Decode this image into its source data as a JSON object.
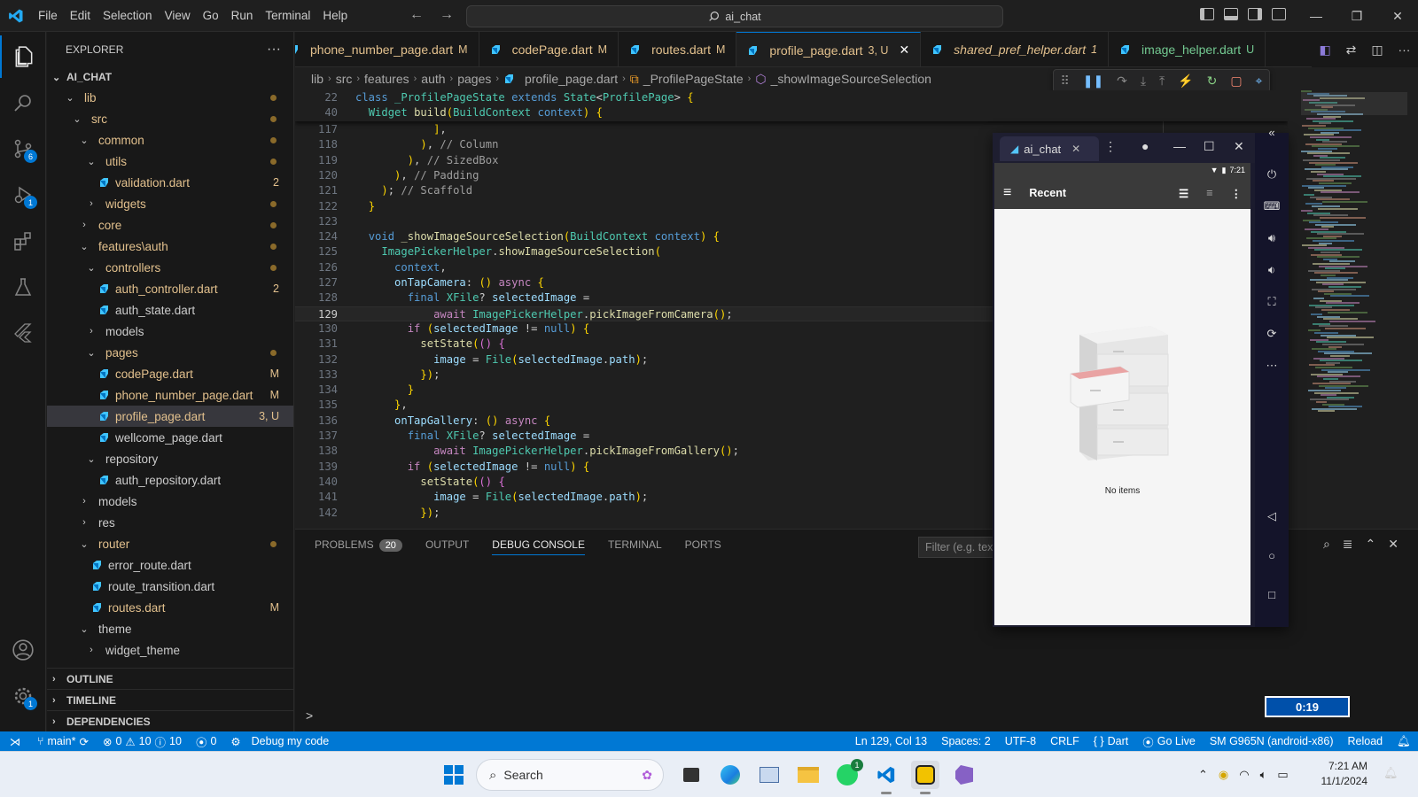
{
  "menu": [
    "File",
    "Edit",
    "Selection",
    "View",
    "Go",
    "Run",
    "Terminal",
    "Help"
  ],
  "command_center": "ai_chat",
  "activity_badges": {
    "source_control": "6",
    "run_debug": "1",
    "accounts_settings": "1"
  },
  "sidebar": {
    "title": "EXPLORER",
    "more": "···",
    "root": "AI_CHAT",
    "tree": [
      {
        "label": "lib",
        "depth": 1,
        "type": "folder-open",
        "color": "yellow",
        "deco": "dot"
      },
      {
        "label": "src",
        "depth": 2,
        "type": "folder-open",
        "color": "yellow",
        "deco": "dot"
      },
      {
        "label": "common",
        "depth": 3,
        "type": "folder-open",
        "color": "yellow",
        "deco": "dot"
      },
      {
        "label": "utils",
        "depth": 4,
        "type": "folder-open",
        "color": "yellow",
        "deco": "dot"
      },
      {
        "label": "validation.dart",
        "depth": 5,
        "type": "file",
        "color": "yellow",
        "deco": "2"
      },
      {
        "label": "widgets",
        "depth": 4,
        "type": "folder",
        "color": "yellow",
        "deco": "dot"
      },
      {
        "label": "core",
        "depth": 3,
        "type": "folder",
        "color": "yellow",
        "deco": "dot"
      },
      {
        "label": "features\\auth",
        "depth": 3,
        "type": "folder-open",
        "color": "yellow",
        "deco": "dot"
      },
      {
        "label": "controllers",
        "depth": 4,
        "type": "folder-open",
        "color": "yellow",
        "deco": "dot"
      },
      {
        "label": "auth_controller.dart",
        "depth": 5,
        "type": "file",
        "color": "yellow",
        "deco": "2"
      },
      {
        "label": "auth_state.dart",
        "depth": 5,
        "type": "file",
        "color": "plain",
        "deco": ""
      },
      {
        "label": "models",
        "depth": 4,
        "type": "folder",
        "color": "plain",
        "deco": ""
      },
      {
        "label": "pages",
        "depth": 4,
        "type": "folder-open",
        "color": "yellow",
        "deco": "dot"
      },
      {
        "label": "codePage.dart",
        "depth": 5,
        "type": "file",
        "color": "yellow",
        "deco": "M"
      },
      {
        "label": "phone_number_page.dart",
        "depth": 5,
        "type": "file",
        "color": "yellow",
        "deco": "M"
      },
      {
        "label": "profile_page.dart",
        "depth": 5,
        "type": "file",
        "color": "yellow",
        "deco": "3, U",
        "selected": true
      },
      {
        "label": "wellcome_page.dart",
        "depth": 5,
        "type": "file",
        "color": "plain",
        "deco": ""
      },
      {
        "label": "repository",
        "depth": 4,
        "type": "folder-open",
        "color": "plain",
        "deco": ""
      },
      {
        "label": "auth_repository.dart",
        "depth": 5,
        "type": "file",
        "color": "plain",
        "deco": ""
      },
      {
        "label": "models",
        "depth": 3,
        "type": "folder",
        "color": "plain",
        "deco": ""
      },
      {
        "label": "res",
        "depth": 3,
        "type": "folder",
        "color": "plain",
        "deco": ""
      },
      {
        "label": "router",
        "depth": 3,
        "type": "folder-open",
        "color": "yellow",
        "deco": "dot"
      },
      {
        "label": "error_route.dart",
        "depth": 4,
        "type": "file",
        "color": "plain",
        "deco": ""
      },
      {
        "label": "route_transition.dart",
        "depth": 4,
        "type": "file",
        "color": "plain",
        "deco": ""
      },
      {
        "label": "routes.dart",
        "depth": 4,
        "type": "file",
        "color": "yellow",
        "deco": "M"
      },
      {
        "label": "theme",
        "depth": 3,
        "type": "folder-open",
        "color": "plain",
        "deco": ""
      },
      {
        "label": "widget_theme",
        "depth": 4,
        "type": "folder",
        "color": "plain",
        "deco": ""
      }
    ],
    "outline": "OUTLINE",
    "timeline": "TIMELINE",
    "dependencies": "DEPENDENCIES"
  },
  "tabs": [
    {
      "label": "phone_number_page.dart",
      "status": "M",
      "color": "yellow",
      "italic": false
    },
    {
      "label": "codePage.dart",
      "status": "M",
      "color": "yellow",
      "italic": false
    },
    {
      "label": "routes.dart",
      "status": "M",
      "color": "yellow",
      "italic": false
    },
    {
      "label": "profile_page.dart",
      "status": "3, U",
      "color": "yellow",
      "italic": false,
      "active": true
    },
    {
      "label": "shared_pref_helper.dart",
      "status": "1",
      "color": "yellow",
      "italic": true
    },
    {
      "label": "image_helper.dart",
      "status": "U",
      "color": "green",
      "italic": false
    }
  ],
  "breadcrumb": [
    "lib",
    "src",
    "features",
    "auth",
    "pages",
    "profile_page.dart",
    "_ProfilePageState",
    "_showImageSourceSelection"
  ],
  "sticky_lines": [
    {
      "n": "22",
      "text": "class _ProfilePageState extends State<ProfilePage> {"
    },
    {
      "n": "40",
      "text": "  Widget build(BuildContext context) {"
    }
  ],
  "code_lines": [
    {
      "n": "117",
      "text": "            ],"
    },
    {
      "n": "118",
      "text": "          ), // Column"
    },
    {
      "n": "119",
      "text": "        ), // SizedBox"
    },
    {
      "n": "120",
      "text": "      ), // Padding"
    },
    {
      "n": "121",
      "text": "    ); // Scaffold"
    },
    {
      "n": "122",
      "text": "  }"
    },
    {
      "n": "123",
      "text": ""
    },
    {
      "n": "124",
      "text": "  void _showImageSourceSelection(BuildContext context) {"
    },
    {
      "n": "125",
      "text": "    ImagePickerHelper.showImageSourceSelection("
    },
    {
      "n": "126",
      "text": "      context,"
    },
    {
      "n": "127",
      "text": "      onTapCamera: () async {"
    },
    {
      "n": "128",
      "text": "        final XFile? selectedImage ="
    },
    {
      "n": "129",
      "text": "            await ImagePickerHelper.pickImageFromCamera();",
      "current": true
    },
    {
      "n": "130",
      "text": "        if (selectedImage != null) {"
    },
    {
      "n": "131",
      "text": "          setState(() {"
    },
    {
      "n": "132",
      "text": "            image = File(selectedImage.path);"
    },
    {
      "n": "133",
      "text": "          });"
    },
    {
      "n": "134",
      "text": "        }"
    },
    {
      "n": "135",
      "text": "      },"
    },
    {
      "n": "136",
      "text": "      onTapGallery: () async {"
    },
    {
      "n": "137",
      "text": "        final XFile? selectedImage ="
    },
    {
      "n": "138",
      "text": "            await ImagePickerHelper.pickImageFromGallery();"
    },
    {
      "n": "139",
      "text": "        if (selectedImage != null) {"
    },
    {
      "n": "140",
      "text": "          setState(() {"
    },
    {
      "n": "141",
      "text": "            image = File(selectedImage.path);"
    },
    {
      "n": "142",
      "text": "          });"
    }
  ],
  "panel": {
    "tabs": [
      "PROBLEMS",
      "OUTPUT",
      "DEBUG CONSOLE",
      "TERMINAL",
      "PORTS"
    ],
    "active_tab": "DEBUG CONSOLE",
    "problems_count": "20",
    "filter_placeholder": "Filter (e.g. text, !exclude)",
    "prompt": ">"
  },
  "emulator": {
    "tab_title": "ai_chat",
    "status_time": "7:21",
    "appbar_title": "Recent",
    "empty_text": "No items"
  },
  "statusbar": {
    "branch": "main*",
    "errors": "0",
    "warnings": "10",
    "infos": "10",
    "ports": "0",
    "debug": "Debug my code",
    "position": "Ln 129, Col 13",
    "spaces": "Spaces: 2",
    "encoding": "UTF-8",
    "eol": "CRLF",
    "language": "Dart",
    "golive": "Go Live",
    "device": "SM G965N (android-x86)",
    "reload": "Reload"
  },
  "timer": "0:19",
  "taskbar": {
    "search_placeholder": "Search",
    "whatsapp_badge": "1",
    "time": "7:21 AM",
    "date": "11/1/2024"
  },
  "colors": {
    "accent": "#0078d4",
    "modified": "#e2c08d",
    "untracked": "#73c991",
    "error": "#f48771"
  }
}
